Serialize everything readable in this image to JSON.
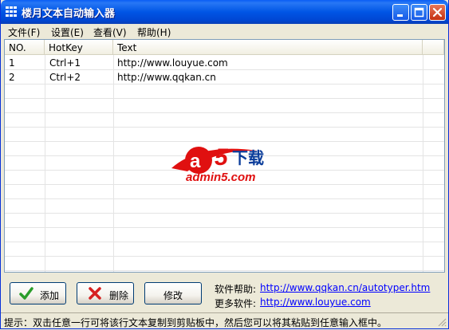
{
  "window": {
    "title": "楼月文本自动输入器"
  },
  "menu": [
    {
      "label": "文件(F)"
    },
    {
      "label": "设置(E)"
    },
    {
      "label": "查看(V)"
    },
    {
      "label": "帮助(H)"
    }
  ],
  "table": {
    "columns": [
      "NO.",
      "HotKey",
      "Text"
    ],
    "rows": [
      {
        "no": "1",
        "hotkey": "Ctrl+1",
        "text": "http://www.louyue.com"
      },
      {
        "no": "2",
        "hotkey": "Ctrl+2",
        "text": "http://www.qqkan.cn"
      }
    ]
  },
  "watermark": {
    "logo_text": "a5下载",
    "domain": "admin5.com"
  },
  "buttons": {
    "add": "添加",
    "delete": "删除",
    "edit": "修改"
  },
  "links": {
    "help_label": "软件帮助:",
    "help_url": "http://www.qqkan.cn/autotyper.htm",
    "more_label": "更多软件:",
    "more_url": "http://www.louyue.com"
  },
  "status": {
    "text": "提示：双击任意一行可将该行文本复制到剪贴板中，然后您可以将其粘贴到任意输入框中。"
  },
  "colors": {
    "titlebar": "#0055e5",
    "link": "#0000ff",
    "add_icon": "#2a9d2a",
    "delete_icon": "#d62020"
  }
}
